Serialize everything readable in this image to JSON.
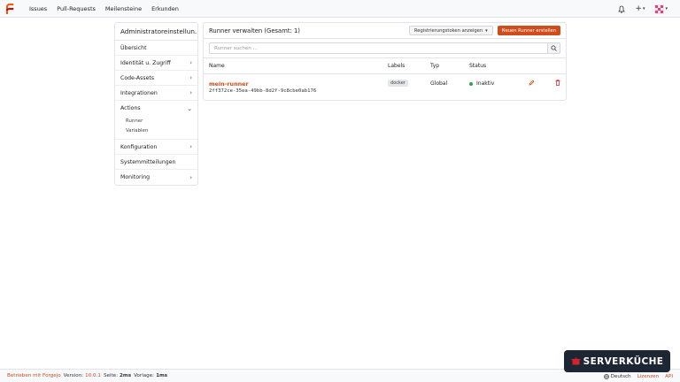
{
  "nav": {
    "links": [
      "Issues",
      "Pull-Requests",
      "Meilensteine",
      "Erkunden"
    ],
    "icons": [
      "bell-icon",
      "plus-icon",
      "avatar"
    ]
  },
  "sidebar": {
    "title": "Administratoreinstellun...",
    "items": [
      {
        "label": "Übersicht"
      },
      {
        "label": "Identität u. Zugriff"
      },
      {
        "label": "Code-Assets"
      },
      {
        "label": "Integrationen"
      },
      {
        "label": "Actions"
      },
      {
        "label": "Konfiguration"
      },
      {
        "label": "Systemmitteilungen"
      },
      {
        "label": "Monitoring"
      }
    ],
    "actions_sub": [
      "Runner",
      "Variablen"
    ]
  },
  "main": {
    "title": "Runner verwalten (Gesamt: 1)",
    "reg_button": "Registrierungstoken anzeigen",
    "new_button": "Neuen Runner erstellen",
    "search_placeholder": "Runner suchen ...",
    "columns": [
      "Name",
      "Labels",
      "Typ",
      "Status"
    ],
    "rows": [
      {
        "name": "mein-runner",
        "id": "2ff372ce-35ea-49bb-8d2f-9c8cbe0ab176",
        "label": "docker",
        "type": "Global",
        "status": "Inaktiv"
      }
    ]
  },
  "footer": {
    "powered": "Betrieben mit Forgejo",
    "version_label": "Version:",
    "version": "10.0.1",
    "page_label": "Seite:",
    "page_time": "2ms",
    "template_label": "Vorlage:",
    "template_time": "1ms",
    "language": "Deutsch",
    "licenses": "Lizenzen",
    "api": "API"
  },
  "badge": {
    "text": "SERVERKÜCHE"
  },
  "colors": {
    "accent": "#cf4c1b",
    "status_ok": "#2ea44f",
    "badge_bg": "#1e2533"
  }
}
